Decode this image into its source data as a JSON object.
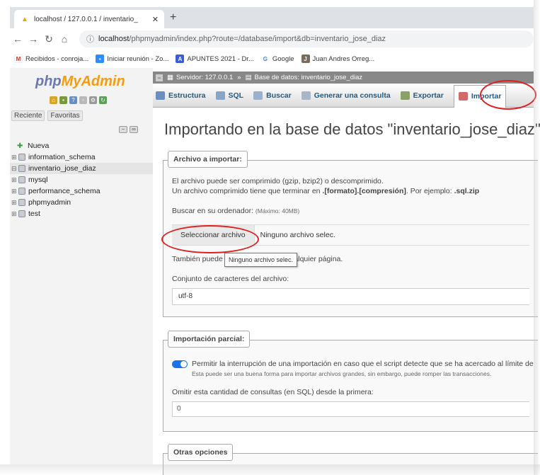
{
  "browser": {
    "tab_title": "localhost / 127.0.0.1 / inventario_",
    "url_host": "localhost",
    "url_path": "/phpmyadmin/index.php?route=/database/import&db=inventario_jose_diaz"
  },
  "bookmarks": [
    {
      "label": "Recibidos - conroja...",
      "icon": "gmail-icon",
      "color": "#d93025",
      "glyph": "M"
    },
    {
      "label": "Iniciar reunión - Zo...",
      "icon": "zoom-icon",
      "color": "#2d8cff",
      "glyph": "▪"
    },
    {
      "label": "APUNTES 2021 - Dr...",
      "icon": "drive-icon",
      "color": "#3b5bdb",
      "glyph": "A"
    },
    {
      "label": "Google",
      "icon": "google-icon",
      "color": "#4285f4",
      "glyph": "G"
    },
    {
      "label": "Juan Andres Orreg...",
      "icon": "profile-icon",
      "color": "#7a6a5a",
      "glyph": "J"
    }
  ],
  "sidebar": {
    "logo_php": "php",
    "logo_myadmin": "MyAdmin",
    "recent": "Reciente",
    "favorites": "Favoritas",
    "items": [
      {
        "label": "Nueva",
        "kind": "new"
      },
      {
        "label": "information_schema",
        "kind": "db"
      },
      {
        "label": "inventario_jose_diaz",
        "kind": "db",
        "active": true
      },
      {
        "label": "mysql",
        "kind": "db"
      },
      {
        "label": "performance_schema",
        "kind": "db"
      },
      {
        "label": "phpmyadmin",
        "kind": "db"
      },
      {
        "label": "test",
        "kind": "db"
      }
    ]
  },
  "breadcrumb": {
    "server": "Servidor: 127.0.0.1",
    "sep": "»",
    "database": "Base de datos: inventario_jose_diaz"
  },
  "tabs": [
    {
      "label": "Estructura",
      "icon": "structure-icon",
      "color": "#6c8ebf"
    },
    {
      "label": "SQL",
      "icon": "sql-icon",
      "color": "#8aa4c8"
    },
    {
      "label": "Buscar",
      "icon": "search-icon",
      "color": "#9bb0cc"
    },
    {
      "label": "Generar una consulta",
      "icon": "query-icon",
      "color": "#a9b6c6"
    },
    {
      "label": "Exportar",
      "icon": "export-icon",
      "color": "#8aa06a"
    },
    {
      "label": "Importar",
      "icon": "import-icon",
      "color": "#d06a6a",
      "active": true
    }
  ],
  "main": {
    "title": "Importando en la base de datos \"inventario_jose_diaz\"",
    "file_section": {
      "legend": "Archivo a importar:",
      "line1": "El archivo puede ser comprimido (gzip, bzip2) o descomprimido.",
      "line2_pre": "Un archivo comprimido tiene que terminar en ",
      "line2_bold": ".[formato].[compresión]",
      "line2_mid": ". Por ejemplo: ",
      "line2_example": ".sql.zip",
      "browse_label": "Buscar en su ordenador:",
      "browse_max": "(Máximo: 40MB)",
      "select_button": "Seleccionar archivo",
      "no_file": "Ninguno archivo selec.",
      "tooltip": "Ninguno archivo selec.",
      "drag_text": "También puede a",
      "drag_text_end": "ualquier página.",
      "charset_label": "Conjunto de caracteres del archivo:",
      "charset_value": "utf-8"
    },
    "partial_section": {
      "legend": "Importación parcial:",
      "allow_interrupt": "Permitir la interrupción de una importación en caso que el script detecte que se ha acercado al límite de",
      "allow_interrupt_hint": "Esta puede ser una buena forma para importar archivos grandes, sin embargo, puede romper las transacciones.",
      "skip_label": "Omitir esta cantidad de consultas (en SQL) desde la primera:",
      "skip_value": "0"
    },
    "other_section": {
      "legend": "Otras opciones"
    }
  },
  "colors": {
    "accent": "#235a81",
    "highlight_circle": "#e02020",
    "toggle_on": "#1a73e8"
  }
}
